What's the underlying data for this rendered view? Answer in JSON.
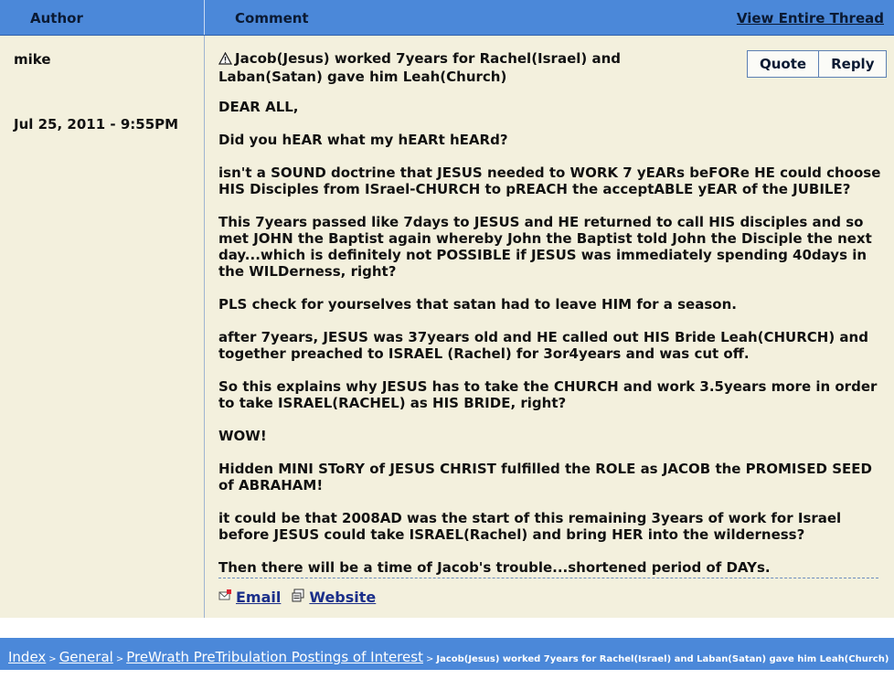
{
  "header": {
    "author_label": "Author",
    "comment_label": "Comment",
    "view_thread_label": "View Entire Thread"
  },
  "post": {
    "author": "mike",
    "date": "Jul 25, 2011 - 9:55PM",
    "title": "Jacob(Jesus) worked 7years for Rachel(Israel) and Laban(Satan) gave him Leah(Church)",
    "quote_label": "Quote",
    "reply_label": "Reply",
    "paragraphs": [
      "DEAR ALL,",
      "Did you hEAR what my hEARt hEARd?",
      "isn't a SOUND doctrine that JESUS needed to WORK 7 yEARs beFORe HE could choose HIS Disciples from ISrael-CHURCH to pREACH the acceptABLE yEAR of the JUBILE?",
      "This 7years passed like 7days to JESUS and HE returned to call HIS disciples and so met JOHN the Baptist again whereby John the Baptist told John the Disciple the next day...which is definitely not POSSIBLE if JESUS was immediately spending 40days in the WILDerness, right?",
      "PLS check for yourselves that satan had to leave HIM for a season.",
      "after 7years, JESUS was 37years old and HE called out HIS Bride Leah(CHURCH) and together preached to ISRAEL (Rachel) for 3or4years and was cut off.",
      "So this explains why JESUS has to take the CHURCH and work 3.5years more in order to take ISRAEL(RACHEL) as HIS BRIDE, right?",
      "WOW!",
      "Hidden MINI SToRY of JESUS CHRIST fulfilled the ROLE as JACOB the PROMISED SEED of ABRAHAM!",
      "it could be that 2008AD was the start of this remaining 3years of work for Israel before JESUS could take ISRAEL(Rachel) and bring HER into the wilderness?",
      "Then there will be a time of Jacob's trouble...shortened period of DAYs."
    ],
    "email_label": "Email",
    "website_label": "Website"
  },
  "breadcrumb": {
    "items": [
      "Index",
      "General",
      "PreWrath PreTribulation Postings of Interest"
    ],
    "separator": ">",
    "current": "Jacob(Jesus) worked 7years for Rachel(Israel) and Laban(Satan) gave him Leah(Church)"
  },
  "colors": {
    "header_bg": "#4b88d9",
    "panel_bg": "#f3f0dd",
    "link": "#1b2f8a"
  },
  "icons": {
    "title": "warning-icon",
    "email": "email-icon",
    "website": "website-icon"
  }
}
